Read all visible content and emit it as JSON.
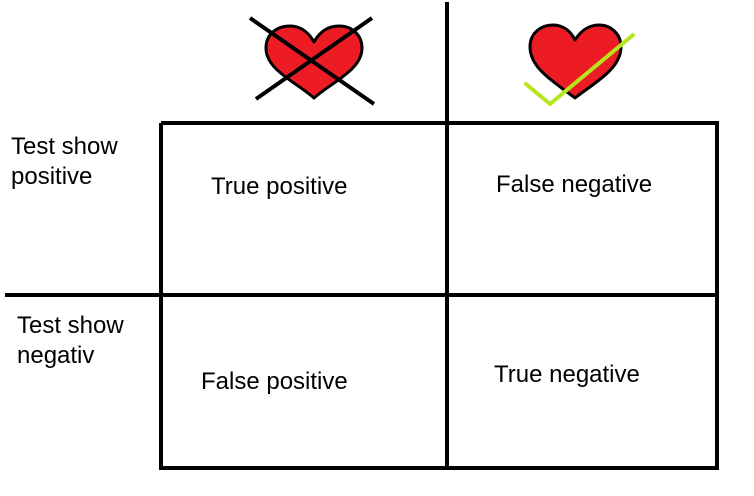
{
  "row_labels": [
    {
      "line1": "Test show",
      "line2": "positive"
    },
    {
      "line1": "Test show",
      "line2": "negativ"
    }
  ],
  "cells": {
    "top_left": "True positive",
    "top_right": "False negative",
    "bottom_left": "False positive",
    "bottom_right": "True negative"
  },
  "icons": {
    "left_column": "heart-crossed-out-icon",
    "right_column": "heart-checkmark-icon"
  },
  "colors": {
    "heart_fill": "#ed1c24",
    "heart_outline": "#000000",
    "cross": "#000000",
    "checkmark": "#b5e61d",
    "grid_lines": "#000000"
  }
}
